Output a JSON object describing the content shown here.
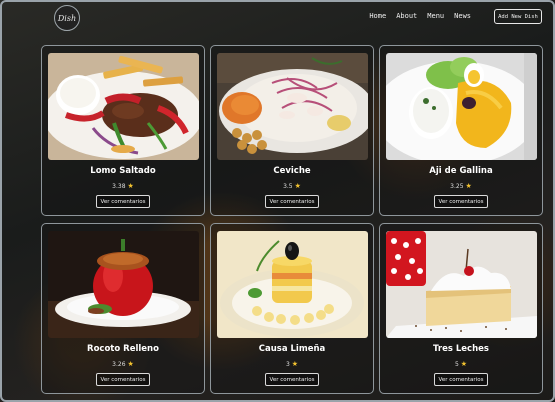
{
  "nav": {
    "logo_text": "Dish",
    "links": [
      "Home",
      "About",
      "Menu",
      "News"
    ],
    "add_button": "Add New Dish"
  },
  "dishes": [
    {
      "name": "Lomo Saltado",
      "rating": "3.38",
      "button": "Ver comentarios",
      "star": "★"
    },
    {
      "name": "Ceviche",
      "rating": "3.5",
      "button": "Ver comentarios",
      "star": "★"
    },
    {
      "name": "Aji de Gallina",
      "rating": "3.25",
      "button": "Ver comentarios",
      "star": "★"
    },
    {
      "name": "Rocoto Relleno",
      "rating": "3.26",
      "button": "Ver comentarios",
      "star": "★"
    },
    {
      "name": "Causa Limeña",
      "rating": "3",
      "button": "Ver comentarios",
      "star": "★"
    },
    {
      "name": "Tres Leches",
      "rating": "5",
      "button": "Ver comentarios",
      "star": "★"
    }
  ],
  "colors": {
    "star": "#f2c230",
    "text": "#ffffff",
    "border": "#8e969b"
  }
}
